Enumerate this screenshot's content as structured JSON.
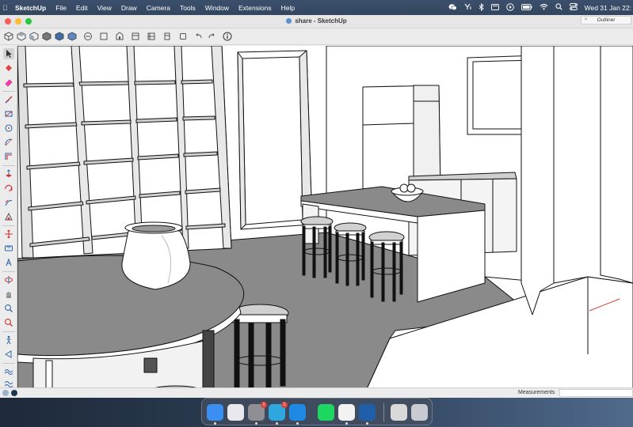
{
  "menubar": {
    "app_name": "SketchUp",
    "items": [
      "File",
      "Edit",
      "View",
      "Draw",
      "Camera",
      "Tools",
      "Window",
      "Extensions",
      "Help"
    ],
    "clock": "Wed 31 Jan  22:"
  },
  "window": {
    "title": "share - SketchUp",
    "outliner_tab": "Outliner",
    "traffic_lights": [
      "#fe5f57",
      "#febc2e",
      "#28c840"
    ]
  },
  "statusbar": {
    "measurements_label": "Measurements",
    "measurements_value": ""
  },
  "dock": {
    "apps": [
      {
        "name": "finder-icon",
        "color": "#3a8ff0"
      },
      {
        "name": "launchpad-icon",
        "color": "#e8e8ee"
      },
      {
        "name": "system-settings-icon",
        "color": "#8e8e93",
        "badge": "1"
      },
      {
        "name": "telegram-icon",
        "color": "#2ea6e0",
        "badge": "1"
      },
      {
        "name": "safari-icon",
        "color": "#1e88e5"
      },
      {
        "name": "spotify-icon",
        "color": "#1ed760"
      },
      {
        "name": "chrome-icon",
        "color": "#f2f2f2"
      },
      {
        "name": "sketchup-icon",
        "color": "#1f5ea8"
      },
      {
        "name": "preview-icon",
        "color": "#d8d8d8"
      },
      {
        "name": "trash-icon",
        "color": "#c8ccd2"
      }
    ]
  }
}
